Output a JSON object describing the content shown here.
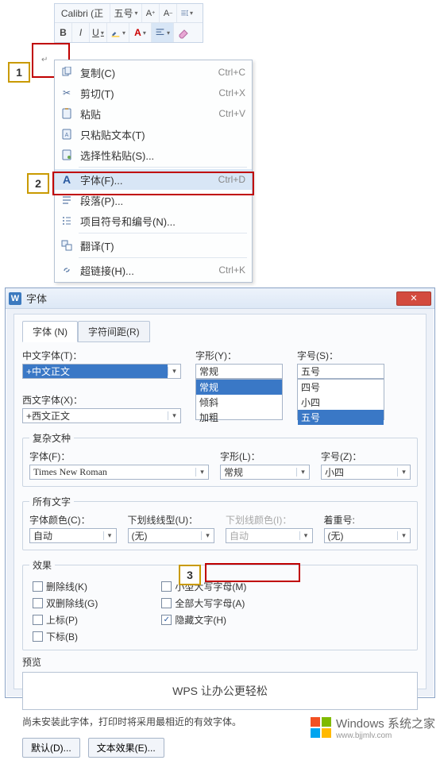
{
  "toolbar": {
    "fontName": "Calibri (正",
    "fontSize": "五号",
    "incFont": "A⁺",
    "decFont": "A⁻"
  },
  "steps": {
    "s1": "1",
    "s2": "2",
    "s3": "3"
  },
  "ctx": {
    "copy": {
      "label": "复制(C)",
      "shortcut": "Ctrl+C"
    },
    "cut": {
      "label": "剪切(T)",
      "shortcut": "Ctrl+X"
    },
    "paste": {
      "label": "粘贴",
      "shortcut": "Ctrl+V"
    },
    "pasteText": {
      "label": "只粘贴文本(T)"
    },
    "pasteSpecial": {
      "label": "选择性粘贴(S)..."
    },
    "font": {
      "label": "字体(F)...",
      "shortcut": "Ctrl+D"
    },
    "para": {
      "label": "段落(P)..."
    },
    "bullets": {
      "label": "项目符号和编号(N)..."
    },
    "translate": {
      "label": "翻译(T)"
    },
    "link": {
      "label": "超链接(H)...",
      "shortcut": "Ctrl+K"
    }
  },
  "dialog": {
    "title": "字体",
    "tabs": {
      "font": "字体 (N)",
      "spacing": "字符间距(R)"
    },
    "cnFontLabel": "中文字体(T)：",
    "cnFontValue": "+中文正文",
    "styleLabel": "字形(Y)：",
    "styleValue": "常规",
    "styleOptions": [
      "常规",
      "倾斜",
      "加粗"
    ],
    "sizeLabel": "字号(S)：",
    "sizeValue": "五号",
    "sizeOptions": [
      "四号",
      "小四",
      "五号"
    ],
    "enFontLabel": "西文字体(X)：",
    "enFontValue": "+西文正文",
    "complex": {
      "legend": "复杂文种",
      "fontLabel": "字体(F)：",
      "fontValue": "Times New Roman",
      "styleLabel": "字形(L)：",
      "styleValue": "常规",
      "sizeLabel": "字号(Z)：",
      "sizeValue": "小四"
    },
    "all": {
      "legend": "所有文字",
      "colorLabel": "字体颜色(C)：",
      "colorValue": "自动",
      "ulLabel": "下划线线型(U)：",
      "ulValue": "(无)",
      "ulColorLabel": "下划线颜色(I)：",
      "ulColorValue": "自动",
      "emphLabel": "着重号:",
      "emphValue": "(无)"
    },
    "fx": {
      "legend": "效果",
      "strike": "删除线(K)",
      "dblStrike": "双删除线(G)",
      "sup": "上标(P)",
      "sub": "下标(B)",
      "smallCaps": "小型大写字母(M)",
      "allCaps": "全部大写字母(A)",
      "hidden": "隐藏文字(H)"
    },
    "preview": {
      "legend": "预览",
      "text": "WPS 让办公更轻松"
    },
    "note": "尚未安装此字体，打印时将采用最相近的有效字体。",
    "btnDefault": "默认(D)...",
    "btnTextFx": "文本效果(E)..."
  },
  "watermark": {
    "brand": "Windows",
    "suffix": "系统之家",
    "url": "www.bjjmlv.com"
  }
}
